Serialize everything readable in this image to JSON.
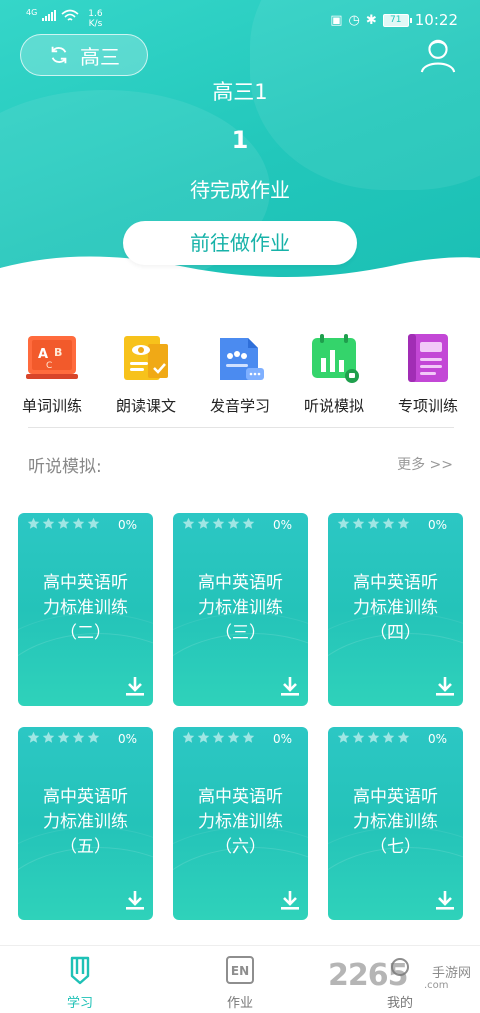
{
  "status_bar": {
    "network": "4G",
    "speed_top": "1.6",
    "speed_bottom": "K/s",
    "battery": "71",
    "time": "10:22"
  },
  "header": {
    "grade_label": "高三",
    "class_name": "高三1",
    "homework_count": "1",
    "homework_text": "待完成作业",
    "go_button": "前往做作业"
  },
  "categories": [
    {
      "label": "单词训练",
      "icon": "abc-board-icon"
    },
    {
      "label": "朗读课文",
      "icon": "reading-book-icon"
    },
    {
      "label": "发音学习",
      "icon": "pronunciation-icon"
    },
    {
      "label": "听说模拟",
      "icon": "listening-chart-icon"
    },
    {
      "label": "专项训练",
      "icon": "special-book-icon"
    }
  ],
  "section": {
    "title": "听说模拟:",
    "more": "更多 >>"
  },
  "cards": [
    {
      "line1": "高中英语听",
      "line2": "力标准训练",
      "line3": "（二）",
      "progress": "0%",
      "stars": 5
    },
    {
      "line1": "高中英语听",
      "line2": "力标准训练",
      "line3": "（三）",
      "progress": "0%",
      "stars": 5
    },
    {
      "line1": "高中英语听",
      "line2": "力标准训练",
      "line3": "（四）",
      "progress": "0%",
      "stars": 5
    },
    {
      "line1": "高中英语听",
      "line2": "力标准训练",
      "line3": "（五）",
      "progress": "0%",
      "stars": 5
    },
    {
      "line1": "高中英语听",
      "line2": "力标准训练",
      "line3": "（六）",
      "progress": "0%",
      "stars": 5
    },
    {
      "line1": "高中英语听",
      "line2": "力标准训练",
      "line3": "（七）",
      "progress": "0%",
      "stars": 5
    }
  ],
  "bottom_nav": [
    {
      "label": "学习",
      "icon": "pencil-icon",
      "active": true
    },
    {
      "label": "作业",
      "icon": "en-icon",
      "active": false
    },
    {
      "label": "我的",
      "icon": "user-icon",
      "active": false
    }
  ],
  "watermark": {
    "number": "2265",
    "cn": "手游网",
    "url": ".com"
  },
  "colors": {
    "primary": "#22c7bb",
    "active_tab": "#1ec1b6",
    "card": "#26c4bc"
  }
}
